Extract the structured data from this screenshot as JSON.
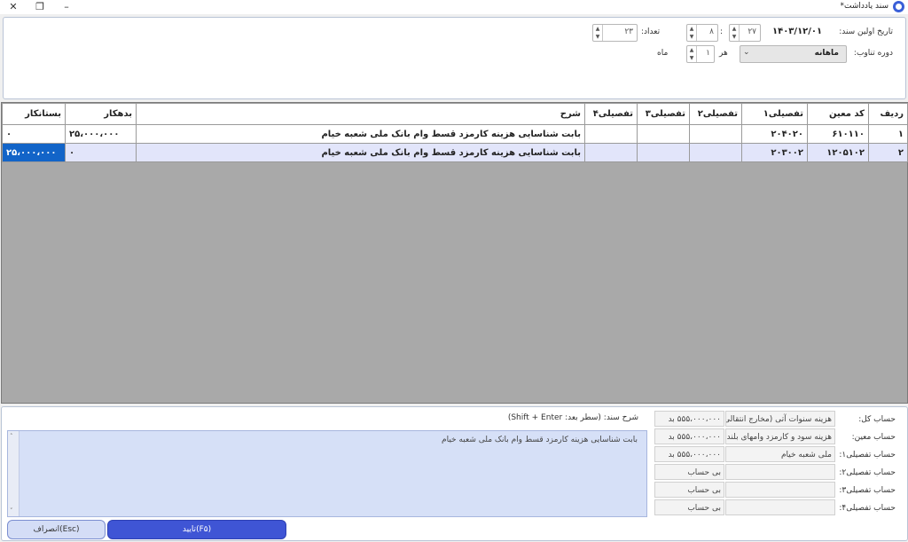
{
  "window": {
    "title": "سند یادداشت*",
    "minimize": "–",
    "restore": "❐",
    "close": "✕"
  },
  "header": {
    "first_date_label": "تاریخ اولین سند:",
    "first_date_value": "۱۴۰۳/۱۲/۰۱",
    "count_label": "تعداد:",
    "count_value": "۲۳",
    "day_value": "۲۷",
    "separator": ":",
    "month_part_value": "۸",
    "period_label": "دوره تناوب:",
    "period_value": "ماهانه",
    "every_label": "هر",
    "every_value": "۱",
    "month_unit": "ماه"
  },
  "table": {
    "columns": [
      "ردیف",
      "کد معین",
      "تفصیلی۱",
      "تفصیلی۲",
      "تفصیلی۳",
      "تفصیلی۴",
      "شرح",
      "بدهکار",
      "بستانکار"
    ],
    "rows": [
      {
        "row": "۱",
        "moein": "۶۱۰۱۱۰",
        "t1": "۲۰۴۰۲۰",
        "t2": "",
        "t3": "",
        "t4": "",
        "desc": "بابت شناسایی هزینه کارمزد قسط وام بانک ملی شعبه خیام",
        "debit": "۲۵،۰۰۰،۰۰۰",
        "credit": "۰"
      },
      {
        "row": "۲",
        "moein": "۱۲۰۵۱۰۲",
        "t1": "۲۰۳۰۰۲",
        "t2": "",
        "t3": "",
        "t4": "",
        "desc": "بابت شناسایی هزینه کارمزد قسط وام بانک ملی شعبه خیام",
        "debit": "۰",
        "credit": "۲۵،۰۰۰،۰۰۰"
      }
    ]
  },
  "accounts": {
    "labels": [
      "حساب کل:",
      "حساب معین:",
      "حساب تفصیلی۱:",
      "حساب تفصیلی۲:",
      "حساب تفصیلی۳:",
      "حساب تفصیلی۴:"
    ],
    "names": [
      "هزینه سنوات آتی (مخارج انتقالی به",
      "هزینه سود و کارمزد وامهای بلند مد",
      "ملی شعبه خیام",
      "",
      "",
      ""
    ],
    "balances": [
      "۵۵۵،۰۰۰،۰۰۰ بد",
      "۵۵۵،۰۰۰،۰۰۰ بد",
      "۵۵۵،۰۰۰،۰۰۰ بد",
      "بی حساب",
      "بی حساب",
      "بی حساب"
    ]
  },
  "description": {
    "label": "شرح سند: (سطر بعد: Shift + Enter)",
    "text": "بابت شناسایی هزینه کارمزد قسط وام بانک ملی شعبه خیام"
  },
  "buttons": {
    "ok": "تایید(F۵)",
    "cancel": "انصراف(Esc)"
  },
  "colors": {
    "accent": "#3f55d5",
    "selected_cell": "#1264c8",
    "selected_row": "#e2e5fa",
    "grid_empty": "#a9a9a9"
  }
}
